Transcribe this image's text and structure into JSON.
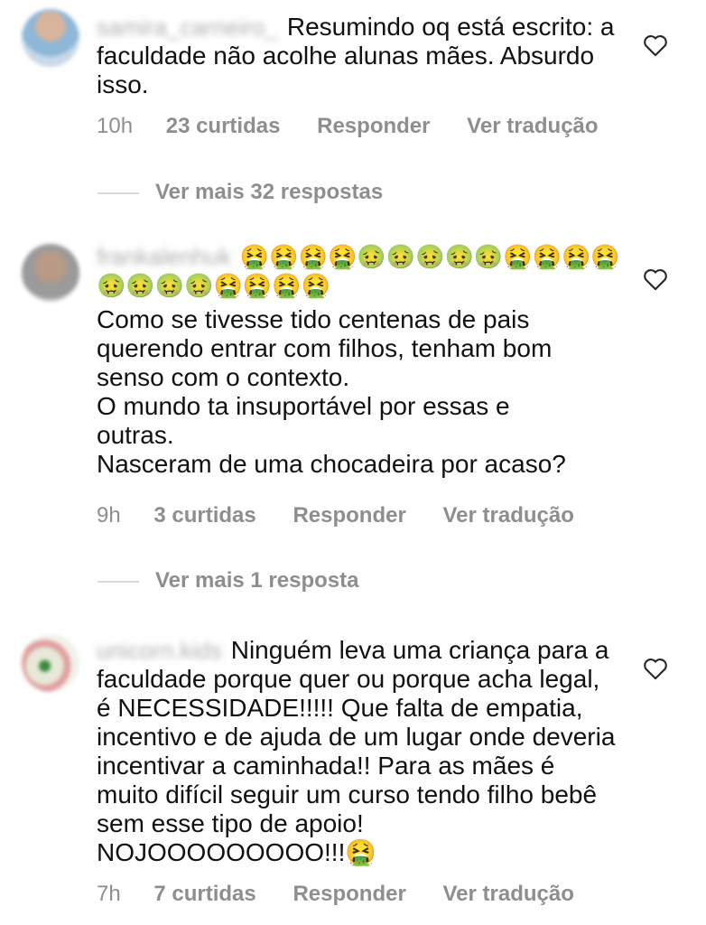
{
  "comments": [
    {
      "username": "samira_carneiro_",
      "text": "Resumindo oq está escrito: a faculdade não acolhe alunas mães. Absurdo isso.",
      "time": "10h",
      "likes": "23 curtidas",
      "reply": "Responder",
      "translate": "Ver tradução",
      "more_replies": "Ver mais 32 respostas"
    },
    {
      "username": "frankalenhuk",
      "emojis": "🤮🤮🤮🤮🤢🤢🤢🤢🤢🤮🤮🤮🤮🤢🤢🤢🤢🤮🤮🤮🤮",
      "lines": [
        "Como se tivesse tido centenas de pais",
        "querendo entrar com filhos, tenham bom",
        "senso com o contexto.",
        "O mundo ta insuportável por essas e",
        "outras.",
        "Nasceram de uma chocadeira por acaso?"
      ],
      "time": "9h",
      "likes": "3 curtidas",
      "reply": "Responder",
      "translate": "Ver tradução",
      "more_replies": "Ver mais 1 resposta"
    },
    {
      "username": "unicorn.kids",
      "text": "Ninguém leva uma criança para a faculdade porque quer ou porque acha legal, é NECESSIDADE!!!!! Que falta de empatia, incentivo e de ajuda de um lugar onde deveria incentivar a caminhada!! Para as mães é muito difícil seguir um curso tendo filho bebê sem esse tipo de apoio! NOJOOOOOOOOO!!!🤮",
      "time": "7h",
      "likes": "7 curtidas",
      "reply": "Responder",
      "translate": "Ver tradução"
    }
  ],
  "icons": {
    "like": "heart-outline-icon"
  },
  "colors": {
    "meta_text": "#8e8e8e",
    "body_text": "#111111",
    "divider": "#d8d8d8"
  }
}
